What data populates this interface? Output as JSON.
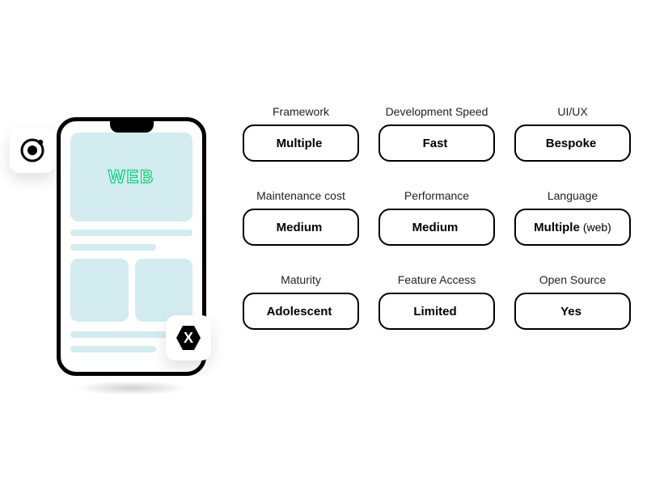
{
  "illustration": {
    "hero_label": "WEB",
    "icons": {
      "ionic": "ionic-icon",
      "xamarin": "xamarin-icon"
    }
  },
  "cards": [
    {
      "category": "Framework",
      "value": "Multiple",
      "suffix": ""
    },
    {
      "category": "Development Speed",
      "value": "Fast",
      "suffix": ""
    },
    {
      "category": "UI/UX",
      "value": "Bespoke",
      "suffix": ""
    },
    {
      "category": "Maintenance cost",
      "value": "Medium",
      "suffix": ""
    },
    {
      "category": "Performance",
      "value": "Medium",
      "suffix": ""
    },
    {
      "category": "Language",
      "value": "Multiple",
      "suffix": "(web)"
    },
    {
      "category": "Maturity",
      "value": "Adolescent",
      "suffix": ""
    },
    {
      "category": "Feature Access",
      "value": "Limited",
      "suffix": ""
    },
    {
      "category": "Open Source",
      "value": "Yes",
      "suffix": ""
    }
  ]
}
